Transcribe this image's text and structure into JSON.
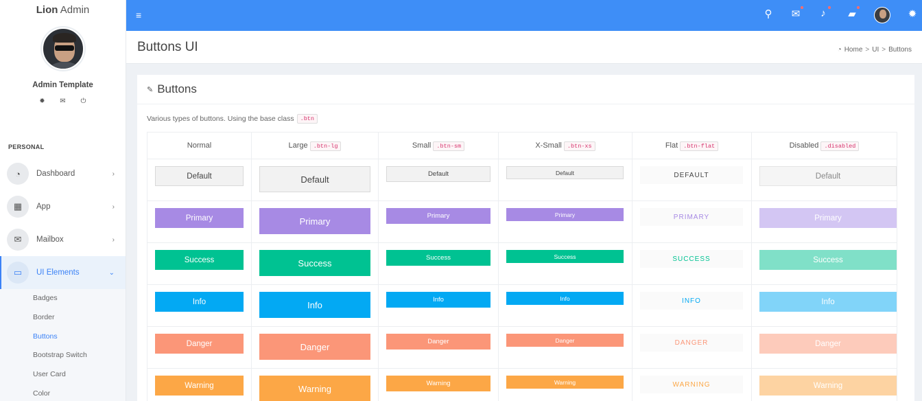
{
  "brand": {
    "bold": "Lion",
    "rest": " Admin"
  },
  "profile": {
    "name": "Admin Template",
    "icons": [
      "gear-icon",
      "mail-icon",
      "power-icon"
    ]
  },
  "sidebar": {
    "heading": "PERSONAL",
    "items": [
      {
        "label": "Dashboard",
        "icon": "dashboard-icon"
      },
      {
        "label": "App",
        "icon": "grid-icon"
      },
      {
        "label": "Mailbox",
        "icon": "envelope-icon"
      },
      {
        "label": "UI Elements",
        "icon": "laptop-icon",
        "active": true
      }
    ],
    "subitems": [
      "Badges",
      "Border",
      "Buttons",
      "Bootstrap Switch",
      "User Card",
      "Color"
    ],
    "current_subitem": "Buttons"
  },
  "topbar": {
    "icons": [
      "search-icon",
      "mail-icon",
      "bell-icon",
      "chat-icon",
      "user-avatar",
      "settings-icon"
    ]
  },
  "page": {
    "title": "Buttons UI"
  },
  "breadcrumb": {
    "home": "Home",
    "sep1": ">",
    "ui": "UI",
    "sep2": ">",
    "current": "Buttons"
  },
  "card": {
    "title": "Buttons",
    "description": "Various types of buttons. Using the base class",
    "desc_code": ".btn"
  },
  "table": {
    "headers": [
      {
        "label": "Normal",
        "code": ""
      },
      {
        "label": "Large",
        "code": ".btn-lg"
      },
      {
        "label": "Small",
        "code": ".btn-sm"
      },
      {
        "label": "X-Small",
        "code": ".btn-xs"
      },
      {
        "label": "Flat",
        "code": ".btn-flat"
      },
      {
        "label": "Disabled",
        "code": ".disabled"
      }
    ],
    "rows": [
      {
        "label": "Default",
        "flat_label": "DEFAULT",
        "color": "#f2f2f2",
        "text": "#444",
        "disabled_color": "#f5f5f5",
        "disabled_text": "#888",
        "flat_text": "#444"
      },
      {
        "label": "Primary",
        "flat_label": "PRIMARY",
        "color": "#a78ae4",
        "text": "#ffffff",
        "disabled_color": "#d3c6f3",
        "disabled_text": "#ffffff",
        "flat_text": "#a78ae4"
      },
      {
        "label": "Success",
        "flat_label": "SUCCESS",
        "color": "#00c292",
        "text": "#ffffff",
        "disabled_color": "#80e0c8",
        "disabled_text": "#ffffff",
        "flat_text": "#00c292"
      },
      {
        "label": "Info",
        "flat_label": "INFO",
        "color": "#03a9f3",
        "text": "#ffffff",
        "disabled_color": "#81d4f9",
        "disabled_text": "#ffffff",
        "flat_text": "#03a9f3"
      },
      {
        "label": "Danger",
        "flat_label": "DANGER",
        "color": "#fb9678",
        "text": "#ffffff",
        "disabled_color": "#fdcbbb",
        "disabled_text": "#ffffff",
        "flat_text": "#fb9678"
      },
      {
        "label": "Warning",
        "flat_label": "WARNING",
        "color": "#fca746",
        "text": "#ffffff",
        "disabled_color": "#fdd3a2",
        "disabled_text": "#ffffff",
        "flat_text": "#fca746"
      }
    ]
  },
  "colors": {
    "topbar": "#3e8ef7",
    "active": "#3b82f6"
  }
}
